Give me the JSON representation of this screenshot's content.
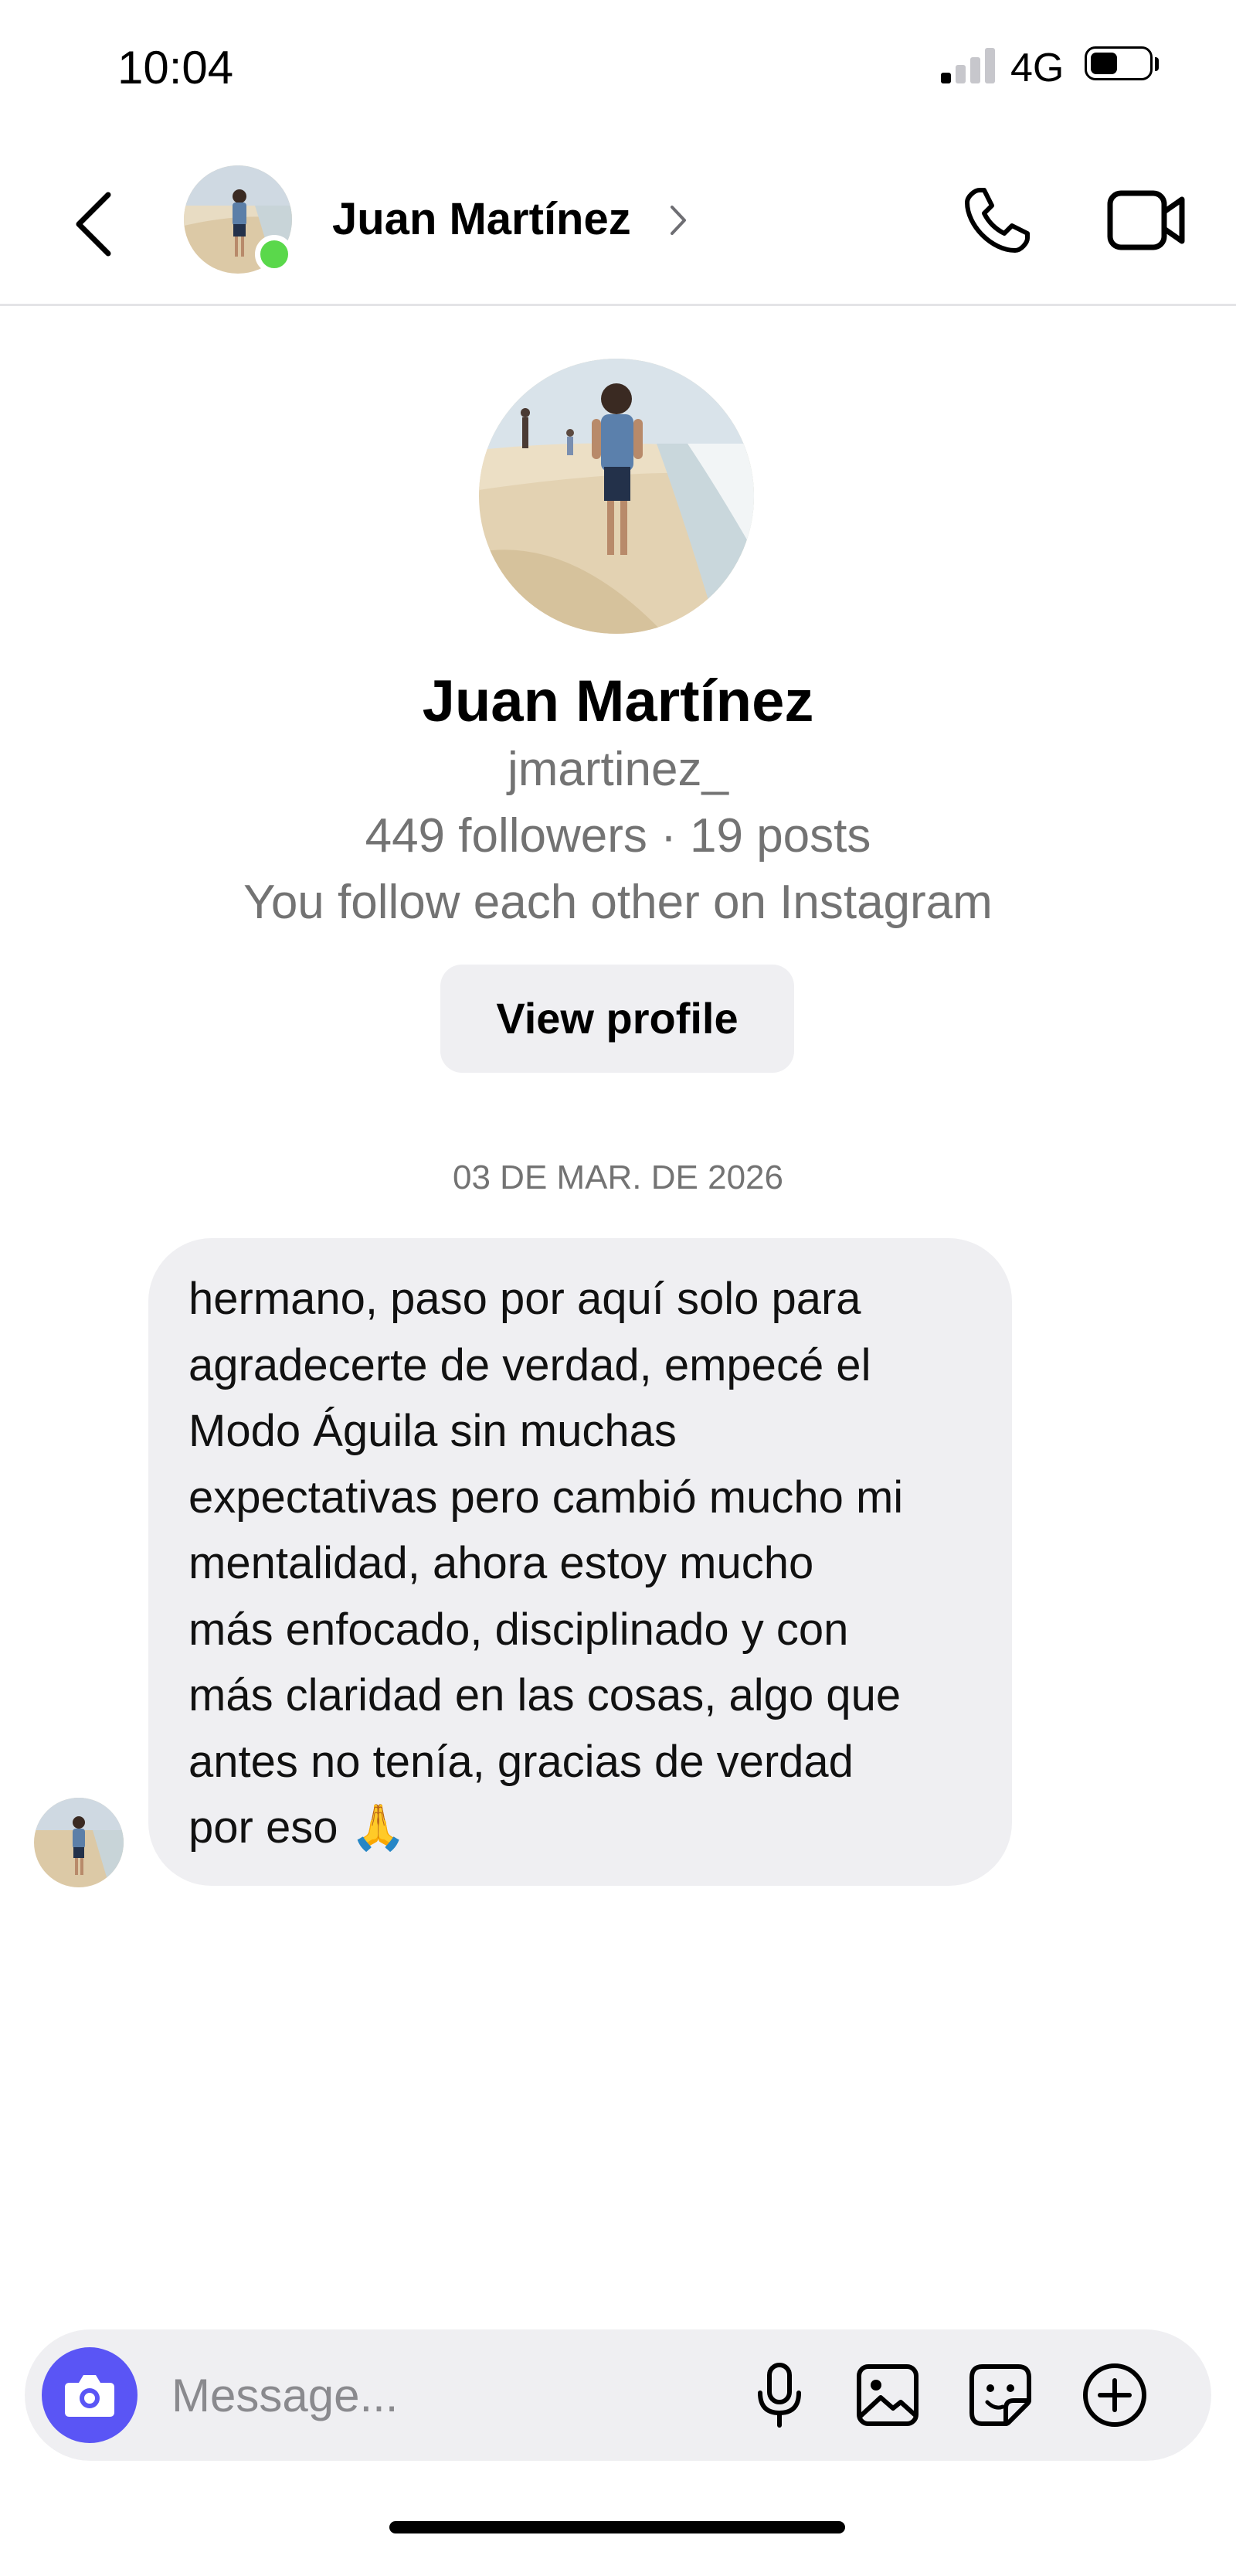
{
  "status_bar": {
    "time": "10:04",
    "network": "4G",
    "signal_bars_active": 1,
    "signal_bars_total": 4,
    "battery_level": 0.45
  },
  "header": {
    "contact_name": "Juan Martínez",
    "online": true,
    "online_color": "#5ad84b",
    "icons": {
      "back": "chevron-left-icon",
      "chevron": "chevron-right-icon",
      "call": "phone-icon",
      "video": "video-camera-icon"
    }
  },
  "profile": {
    "name": "Juan Martínez",
    "username": "jmartinez_",
    "stats": "449 followers · 19 posts",
    "mutual": "You follow each other on Instagram",
    "view_profile_label": "View profile"
  },
  "conversation": {
    "date_divider": "03 DE MAR. DE 2026",
    "messages": [
      {
        "sender": "Juan Martínez",
        "direction": "incoming",
        "text": "hermano, paso por aquí solo para\nagradecerte de verdad, empecé el\nModo Águila sin muchas\nexpectativas pero cambió mucho mi\nmentalidad, ahora estoy mucho\nmás enfocado, disciplinado y con\nmás claridad en las cosas, algo que\nantes no tenía, gracias de verdad\npor eso 🙏"
      }
    ]
  },
  "composer": {
    "placeholder": "Message...",
    "accent_color": "#5a55f5",
    "icons": {
      "camera": "camera-icon",
      "mic": "microphone-icon",
      "gallery": "image-icon",
      "sticker": "sticker-icon",
      "add": "plus-circle-icon"
    }
  }
}
